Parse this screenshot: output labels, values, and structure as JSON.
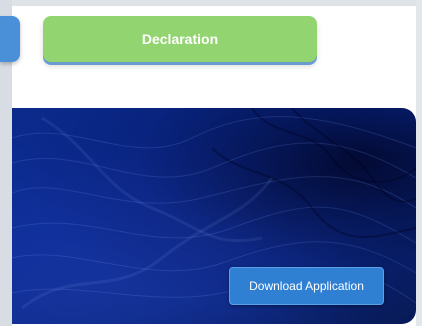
{
  "steps": {
    "declaration_label": "Declaration"
  },
  "hero": {
    "download_label": "Download Application"
  },
  "colors": {
    "declaration_bg": "#92d470",
    "hero_bg": "#0a2a95",
    "download_bg": "#2f7fd3"
  }
}
